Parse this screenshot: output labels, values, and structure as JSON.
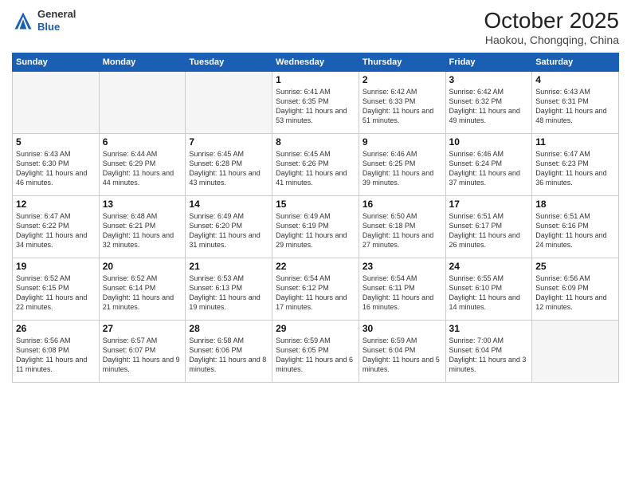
{
  "header": {
    "logo_line1": "General",
    "logo_line2": "Blue",
    "month": "October 2025",
    "location": "Haokou, Chongqing, China"
  },
  "weekdays": [
    "Sunday",
    "Monday",
    "Tuesday",
    "Wednesday",
    "Thursday",
    "Friday",
    "Saturday"
  ],
  "rows": [
    [
      {
        "day": "",
        "info": ""
      },
      {
        "day": "",
        "info": ""
      },
      {
        "day": "",
        "info": ""
      },
      {
        "day": "1",
        "info": "Sunrise: 6:41 AM\nSunset: 6:35 PM\nDaylight: 11 hours\nand 53 minutes."
      },
      {
        "day": "2",
        "info": "Sunrise: 6:42 AM\nSunset: 6:33 PM\nDaylight: 11 hours\nand 51 minutes."
      },
      {
        "day": "3",
        "info": "Sunrise: 6:42 AM\nSunset: 6:32 PM\nDaylight: 11 hours\nand 49 minutes."
      },
      {
        "day": "4",
        "info": "Sunrise: 6:43 AM\nSunset: 6:31 PM\nDaylight: 11 hours\nand 48 minutes."
      }
    ],
    [
      {
        "day": "5",
        "info": "Sunrise: 6:43 AM\nSunset: 6:30 PM\nDaylight: 11 hours\nand 46 minutes."
      },
      {
        "day": "6",
        "info": "Sunrise: 6:44 AM\nSunset: 6:29 PM\nDaylight: 11 hours\nand 44 minutes."
      },
      {
        "day": "7",
        "info": "Sunrise: 6:45 AM\nSunset: 6:28 PM\nDaylight: 11 hours\nand 43 minutes."
      },
      {
        "day": "8",
        "info": "Sunrise: 6:45 AM\nSunset: 6:26 PM\nDaylight: 11 hours\nand 41 minutes."
      },
      {
        "day": "9",
        "info": "Sunrise: 6:46 AM\nSunset: 6:25 PM\nDaylight: 11 hours\nand 39 minutes."
      },
      {
        "day": "10",
        "info": "Sunrise: 6:46 AM\nSunset: 6:24 PM\nDaylight: 11 hours\nand 37 minutes."
      },
      {
        "day": "11",
        "info": "Sunrise: 6:47 AM\nSunset: 6:23 PM\nDaylight: 11 hours\nand 36 minutes."
      }
    ],
    [
      {
        "day": "12",
        "info": "Sunrise: 6:47 AM\nSunset: 6:22 PM\nDaylight: 11 hours\nand 34 minutes."
      },
      {
        "day": "13",
        "info": "Sunrise: 6:48 AM\nSunset: 6:21 PM\nDaylight: 11 hours\nand 32 minutes."
      },
      {
        "day": "14",
        "info": "Sunrise: 6:49 AM\nSunset: 6:20 PM\nDaylight: 11 hours\nand 31 minutes."
      },
      {
        "day": "15",
        "info": "Sunrise: 6:49 AM\nSunset: 6:19 PM\nDaylight: 11 hours\nand 29 minutes."
      },
      {
        "day": "16",
        "info": "Sunrise: 6:50 AM\nSunset: 6:18 PM\nDaylight: 11 hours\nand 27 minutes."
      },
      {
        "day": "17",
        "info": "Sunrise: 6:51 AM\nSunset: 6:17 PM\nDaylight: 11 hours\nand 26 minutes."
      },
      {
        "day": "18",
        "info": "Sunrise: 6:51 AM\nSunset: 6:16 PM\nDaylight: 11 hours\nand 24 minutes."
      }
    ],
    [
      {
        "day": "19",
        "info": "Sunrise: 6:52 AM\nSunset: 6:15 PM\nDaylight: 11 hours\nand 22 minutes."
      },
      {
        "day": "20",
        "info": "Sunrise: 6:52 AM\nSunset: 6:14 PM\nDaylight: 11 hours\nand 21 minutes."
      },
      {
        "day": "21",
        "info": "Sunrise: 6:53 AM\nSunset: 6:13 PM\nDaylight: 11 hours\nand 19 minutes."
      },
      {
        "day": "22",
        "info": "Sunrise: 6:54 AM\nSunset: 6:12 PM\nDaylight: 11 hours\nand 17 minutes."
      },
      {
        "day": "23",
        "info": "Sunrise: 6:54 AM\nSunset: 6:11 PM\nDaylight: 11 hours\nand 16 minutes."
      },
      {
        "day": "24",
        "info": "Sunrise: 6:55 AM\nSunset: 6:10 PM\nDaylight: 11 hours\nand 14 minutes."
      },
      {
        "day": "25",
        "info": "Sunrise: 6:56 AM\nSunset: 6:09 PM\nDaylight: 11 hours\nand 12 minutes."
      }
    ],
    [
      {
        "day": "26",
        "info": "Sunrise: 6:56 AM\nSunset: 6:08 PM\nDaylight: 11 hours\nand 11 minutes."
      },
      {
        "day": "27",
        "info": "Sunrise: 6:57 AM\nSunset: 6:07 PM\nDaylight: 11 hours\nand 9 minutes."
      },
      {
        "day": "28",
        "info": "Sunrise: 6:58 AM\nSunset: 6:06 PM\nDaylight: 11 hours\nand 8 minutes."
      },
      {
        "day": "29",
        "info": "Sunrise: 6:59 AM\nSunset: 6:05 PM\nDaylight: 11 hours\nand 6 minutes."
      },
      {
        "day": "30",
        "info": "Sunrise: 6:59 AM\nSunset: 6:04 PM\nDaylight: 11 hours\nand 5 minutes."
      },
      {
        "day": "31",
        "info": "Sunrise: 7:00 AM\nSunset: 6:04 PM\nDaylight: 11 hours\nand 3 minutes."
      },
      {
        "day": "",
        "info": ""
      }
    ]
  ]
}
